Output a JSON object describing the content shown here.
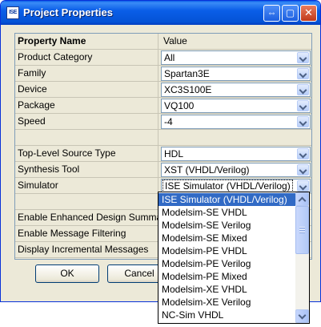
{
  "window": {
    "title": "Project Properties",
    "app_icon_text": "ISE",
    "title_buttons": [
      "help-restore",
      "maximize",
      "close"
    ]
  },
  "grid": {
    "header": {
      "name": "Property Name",
      "value": "Value"
    },
    "rows": [
      {
        "name": "Product Category",
        "value": "All",
        "type": "combo"
      },
      {
        "name": "Family",
        "value": "Spartan3E",
        "type": "combo"
      },
      {
        "name": "Device",
        "value": "XC3S100E",
        "type": "combo"
      },
      {
        "name": "Package",
        "value": "VQ100",
        "type": "combo"
      },
      {
        "name": "Speed",
        "value": "-4",
        "type": "combo"
      },
      {
        "name": "",
        "value": "",
        "type": "blank"
      },
      {
        "name": "Top-Level Source Type",
        "value": "HDL",
        "type": "combo"
      },
      {
        "name": "Synthesis Tool",
        "value": "XST (VHDL/Verilog)",
        "type": "combo"
      },
      {
        "name": "Simulator",
        "value": "ISE Simulator (VHDL/Verilog)",
        "type": "combo"
      },
      {
        "name": "",
        "value": "",
        "type": "blank"
      },
      {
        "name": "Enable Enhanced Design Summary",
        "value": "",
        "type": "covered"
      },
      {
        "name": "Enable Message Filtering",
        "value": "",
        "type": "covered"
      },
      {
        "name": "Display Incremental Messages",
        "value": "",
        "type": "covered"
      }
    ]
  },
  "buttons": {
    "ok": "OK",
    "cancel": "Cancel"
  },
  "simulator_dropdown": {
    "options": [
      "ISE Simulator (VHDL/Verilog)",
      "Modelsim-SE VHDL",
      "Modelsim-SE Verilog",
      "Modelsim-SE Mixed",
      "Modelsim-PE VHDL",
      "Modelsim-PE Verilog",
      "Modelsim-PE Mixed",
      "Modelsim-XE VHDL",
      "Modelsim-XE Verilog",
      "NC-Sim VHDL"
    ],
    "selected_index": 0
  },
  "colors": {
    "titlebar": "#0a5ee8",
    "dialog_bg": "#ece9d8",
    "selection": "#316ac5"
  }
}
